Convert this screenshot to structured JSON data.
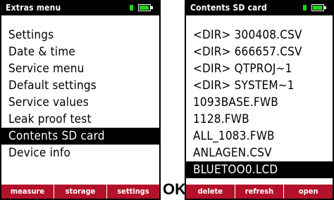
{
  "left_screen": {
    "title": "Extras menu",
    "items": [
      "Settings",
      "Date & time",
      "Service menu",
      "Default settings",
      "Service values",
      "Leak proof test",
      "Contents SD card",
      "Device info"
    ],
    "selected_index": 6,
    "softkeys": [
      "measure",
      "storage",
      "settings"
    ]
  },
  "ok_label": "OK",
  "right_screen": {
    "title": "Contents SD card",
    "items": [
      "<DIR> 300408.CSV",
      "<DIR> 666657.CSV",
      "<DIR> QTPROJ~1",
      "<DIR> SYSTEM~1",
      "1093BASE.FWB",
      "1128.FWB",
      "ALL_1083.FWB",
      "ANLAGEN.CSV",
      "BLUETOO0.LCD"
    ],
    "selected_index": 8,
    "softkeys": [
      "delete",
      "refresh",
      "open"
    ]
  },
  "colors": {
    "softkey_bar": "#b3122a",
    "battery_fill": "#22d31c",
    "title_bar": "#000000",
    "selection": "#000000"
  },
  "icons": {
    "battery": "battery-icon"
  }
}
